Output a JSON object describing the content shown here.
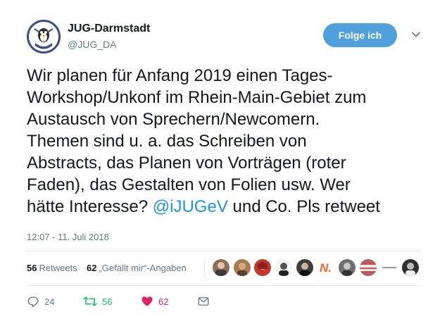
{
  "user": {
    "name": "JUG-Darmstadt",
    "handle": "@JUG_DA",
    "avatar_text": "JUG Darmstadt"
  },
  "follow_button": {
    "label": "Folge ich"
  },
  "tweet": {
    "text_before": "Wir planen für Anfang 2019 einen Tages-\nWorkshop/Unkonf im Rhein-Main-Gebiet zum\nAustausch von Sprechern/Newcomern.\nThemen sind u. a. das Schreiben von\nAbstracts, das Planen von Vorträgen (roter\nFaden), das Gestalten von Folien usw. Wer\nhätte Interesse? ",
    "mention": "@iJUGeV",
    "text_after": " und Co. Pls retweet"
  },
  "timestamp": "12:07 - 11. Juli 2018",
  "stats": {
    "retweets_count": "56",
    "retweets_label": "Retweets",
    "likes_count": "62",
    "likes_label": "„Gefällt mir“-Angaben"
  },
  "likers": [
    {
      "name": "liker-1",
      "color": "#8a6d5a"
    },
    {
      "name": "liker-2",
      "color": "#a67c52"
    },
    {
      "name": "liker-3",
      "color": "#c0392b"
    },
    {
      "name": "liker-4",
      "color": "#f4f4f4"
    },
    {
      "name": "liker-5",
      "color": "#3d3d3d"
    },
    {
      "name": "liker-6",
      "text": "N.",
      "color": "#f26522"
    },
    {
      "name": "liker-7",
      "color": "#6d6d6d"
    },
    {
      "name": "liker-8",
      "color": "#b85a5a"
    },
    {
      "name": "liker-9",
      "color": "#dddddd"
    },
    {
      "name": "liker-10",
      "color": "#2f2f2f"
    }
  ],
  "actions": {
    "replies": "24",
    "retweets": "56",
    "likes": "62"
  },
  "colors": {
    "accent": "#1b95e0",
    "follow_button": "#4fa0dc",
    "retweet": "#17bf63",
    "like": "#e0245e",
    "muted": "#657786"
  }
}
